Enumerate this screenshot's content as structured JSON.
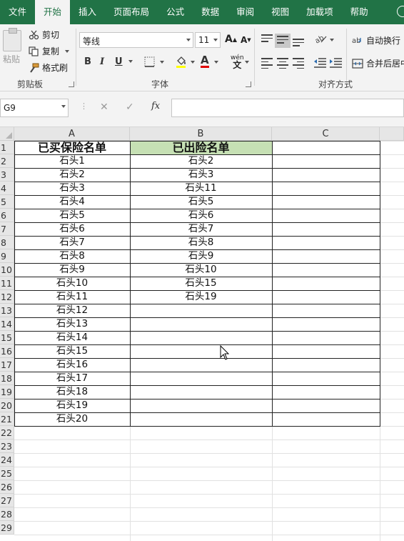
{
  "ribbon_tabs": [
    "文件",
    "开始",
    "插入",
    "页面布局",
    "公式",
    "数据",
    "审阅",
    "视图",
    "加载项",
    "帮助"
  ],
  "active_tab_index": 1,
  "clipboard": {
    "paste_label": "粘贴",
    "cut_label": "剪切",
    "copy_label": "复制",
    "format_painter_label": "格式刷",
    "group_label": "剪贴板"
  },
  "font": {
    "name": "等线",
    "size": "11",
    "grow_label": "A",
    "shrink_label": "A",
    "bold_label": "B",
    "italic_label": "I",
    "underline_label": "U",
    "font_color_label": "A",
    "phonetic_label": "wén",
    "group_label": "字体",
    "font_color": "#e00000"
  },
  "alignment": {
    "wrap_label": "自动换行",
    "merge_label": "合并后居中",
    "group_label": "对齐方式"
  },
  "formula_bar": {
    "name_box": "G9",
    "cancel": "✕",
    "enter": "✓",
    "fx": "fx",
    "value": ""
  },
  "columns": [
    "A",
    "B",
    "C"
  ],
  "row_numbers": [
    "1",
    "2",
    "3",
    "4",
    "5",
    "6",
    "7",
    "8",
    "9",
    "10",
    "11",
    "12",
    "13",
    "14",
    "15",
    "16",
    "17",
    "18",
    "19",
    "20",
    "21",
    "22",
    "23",
    "24",
    "25",
    "26",
    "27",
    "28",
    "29"
  ],
  "table": {
    "header_a": "已买保险名单",
    "header_b": "已出险名单",
    "header_b_fill": "#c6e0b4",
    "col_a": [
      "石头1",
      "石头2",
      "石头3",
      "石头4",
      "石头5",
      "石头6",
      "石头7",
      "石头8",
      "石头9",
      "石头10",
      "石头11",
      "石头12",
      "石头13",
      "石头14",
      "石头15",
      "石头16",
      "石头17",
      "石头18",
      "石头19",
      "石头20"
    ],
    "col_b": [
      "石头2",
      "石头3",
      "石头11",
      "石头5",
      "石头6",
      "石头7",
      "石头8",
      "石头9",
      "石头10",
      "石头15",
      "石头19"
    ]
  },
  "colors": {
    "ribbon_green": "#217346",
    "ribbon_bg": "#f3f3f3",
    "header_bg": "#e6e6e6"
  }
}
